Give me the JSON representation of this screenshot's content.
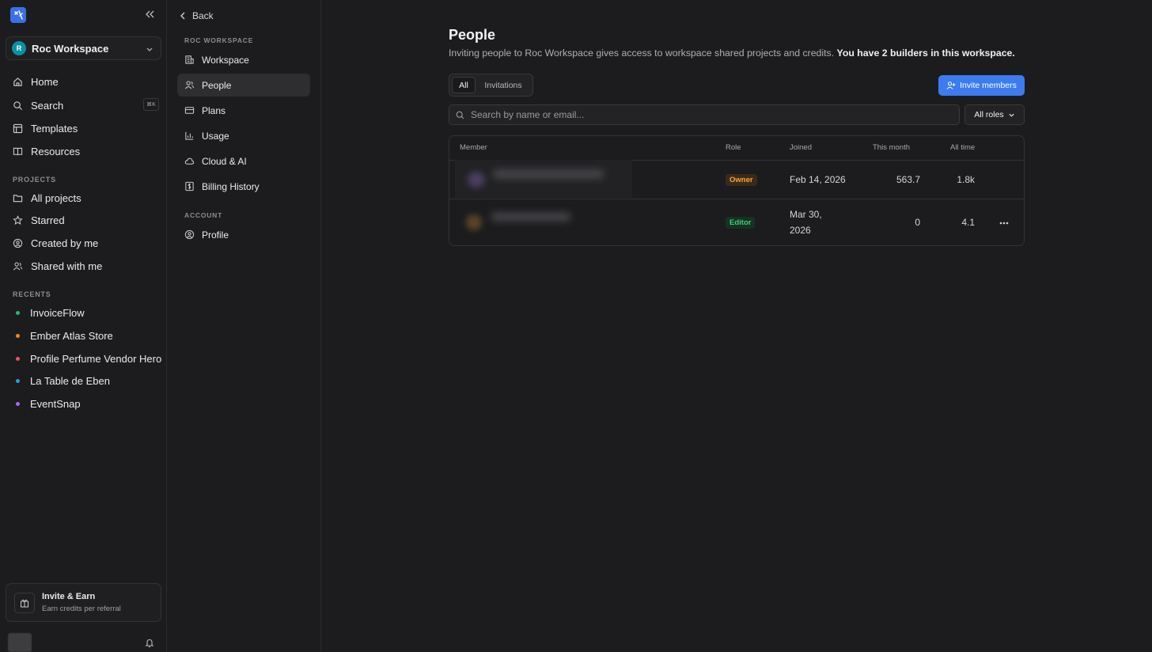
{
  "app": {
    "workspace_initial": "R",
    "workspace_name": "Roc Workspace",
    "shortcut": "⌘K"
  },
  "nav": [
    {
      "label": "Home",
      "icon": "home-icon"
    },
    {
      "label": "Search",
      "icon": "search-icon"
    },
    {
      "label": "Templates",
      "icon": "templates-icon"
    },
    {
      "label": "Resources",
      "icon": "book-icon"
    }
  ],
  "projects_label": "PROJECTS",
  "projects": [
    {
      "label": "All projects",
      "icon": "folder-icon"
    },
    {
      "label": "Starred",
      "icon": "star-icon"
    },
    {
      "label": "Created by me",
      "icon": "user-circle-icon"
    },
    {
      "label": "Shared with me",
      "icon": "users-icon"
    }
  ],
  "recents_label": "RECENTS",
  "recents": [
    {
      "label": "InvoiceFlow",
      "color": "#1fbf74"
    },
    {
      "label": "Ember Atlas Store",
      "color": "#f08a24"
    },
    {
      "label": "Profile Perfume Vendor Hero",
      "color": "#ef4f6e"
    },
    {
      "label": "La Table de Eben",
      "color": "#1aa7d6"
    },
    {
      "label": "EventSnap",
      "color": "#a06cf0"
    }
  ],
  "invite_card": {
    "title": "Invite & Earn",
    "subtitle": "Earn credits per referral"
  },
  "settings": {
    "back_label": "Back",
    "workspace_section": "ROC WORKSPACE",
    "items": [
      "Workspace",
      "People",
      "Plans",
      "Usage",
      "Cloud & AI",
      "Billing History"
    ],
    "account_section": "ACCOUNT",
    "account_items": [
      "Profile"
    ]
  },
  "main": {
    "title": "People",
    "description": "Inviting people to Roc Workspace gives access to workspace shared projects and credits.",
    "description_bold": "You have 2 builders in this workspace.",
    "tabs": [
      "All",
      "Invitations"
    ],
    "invite_button": "Invite members",
    "search_placeholder": "Search by name or email...",
    "roles_filter": "All roles",
    "columns": [
      "Member",
      "Role",
      "Joined",
      "This month",
      "All time"
    ],
    "rows": [
      {
        "role": "Owner",
        "joined": "Feb 14, 2026",
        "joined_line2": "",
        "this_month": "563.7",
        "all_time": "1.8k"
      },
      {
        "role": "Editor",
        "joined": "Mar 30,",
        "joined_line2": "2026",
        "this_month": "0",
        "all_time": "4.1"
      }
    ]
  },
  "colors": {
    "accent": "#3d7bf0",
    "owner": "#f2a641",
    "editor": "#3ccf7a"
  }
}
